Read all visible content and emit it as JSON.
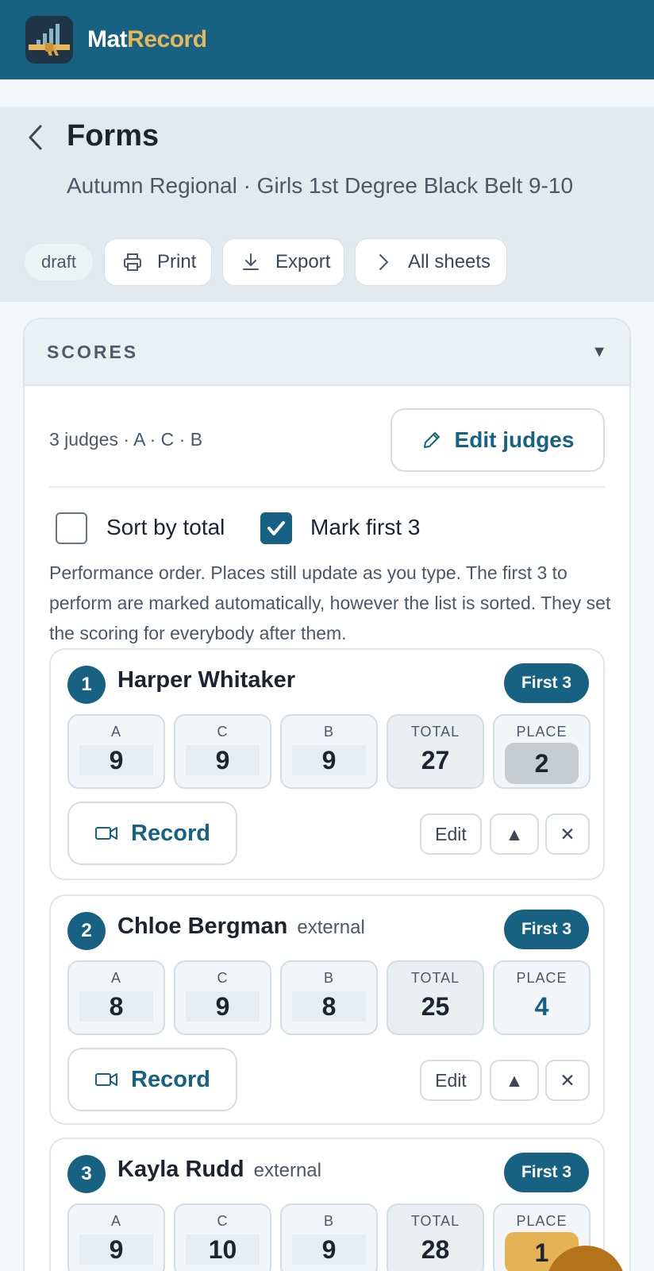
{
  "app": {
    "brand_main": "Mat",
    "brand_accent": "Record"
  },
  "header": {
    "title": "Forms",
    "subtitle": "Autumn Regional · Girls 1st Degree Black Belt 9-10",
    "status": "draft",
    "actions": [
      {
        "label": "Print",
        "icon": "printer-icon"
      },
      {
        "label": "Export",
        "icon": "download-icon"
      },
      {
        "label": "All sheets",
        "icon": "chevron-right-icon"
      }
    ]
  },
  "scores": {
    "section_label": "SCORES",
    "judges_text": "3 judges · A · C · B",
    "edit_judges_label": "Edit judges",
    "sort_by_total": {
      "label": "Sort by total",
      "checked": false
    },
    "mark_first": {
      "label": "Mark first 3",
      "checked": true
    },
    "note": "Performance order. Places still update as you type. The first 3 to perform are marked automatically, however the list is sorted. They set the scoring for everybody after them.",
    "headers": {
      "a": "A",
      "c": "C",
      "b": "B",
      "total": "TOTAL",
      "place": "PLACE"
    },
    "record_label": "Record",
    "edit_label": "Edit",
    "up_label": "▲",
    "remove_label": "✕",
    "first3_badge": "First 3",
    "entries": [
      {
        "order": "1",
        "name": "Harper Whitaker",
        "tag": "",
        "a": "9",
        "c": "9",
        "b": "9",
        "total": "27",
        "place": "2"
      },
      {
        "order": "2",
        "name": "Chloe Bergman",
        "tag": "external",
        "a": "8",
        "c": "9",
        "b": "8",
        "total": "25",
        "place": "4"
      },
      {
        "order": "3",
        "name": "Kayla Rudd",
        "tag": "external",
        "a": "9",
        "c": "10",
        "b": "9",
        "total": "28",
        "place": "1"
      }
    ]
  },
  "colors": {
    "primary": "#176183",
    "accent": "#e8b75a",
    "gold": "#e4b353",
    "silver": "#c7ccd0"
  }
}
